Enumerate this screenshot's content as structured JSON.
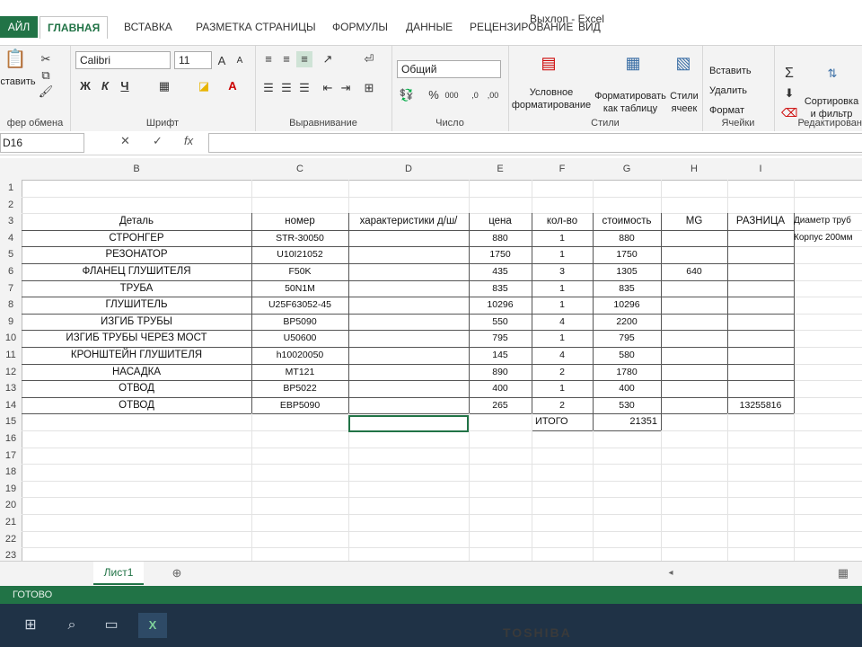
{
  "title": "Выхлоп - Excel",
  "tabs": {
    "file": "АЙЛ",
    "home": "ГЛАВНАЯ",
    "insert": "ВСТАВКА",
    "layout": "РАЗМЕТКА СТРАНИЦЫ",
    "formulas": "ФОРМУЛЫ",
    "data": "ДАННЫЕ",
    "review": "РЕЦЕНЗИРОВАНИЕ",
    "view": "ВИД"
  },
  "ribbon": {
    "paste": "ставить",
    "clipboard": "фер обмена",
    "font_name": "Calibri",
    "font_size": "11",
    "bold": "Ж",
    "italic": "К",
    "underline": "Ч",
    "font_group": "Шрифт",
    "align_group": "Выравнивание",
    "number_format": "Общий",
    "number_group": "Число",
    "cond_format": "Условное",
    "cond_format2": "форматирование",
    "format_table": "Форматировать",
    "format_table2": "как таблицу",
    "cell_styles": "Стили",
    "cell_styles2": "ячеек",
    "styles_group": "Стили",
    "insert": "Вставить",
    "delete": "Удалить",
    "format": "Формат",
    "cells_group": "Ячейки",
    "sort": "Сортировка",
    "sort2": "и фильтр",
    "edit_group": "Редактирован"
  },
  "formula_bar": {
    "name_box": "D16",
    "cancel": "✕",
    "enter": "✓",
    "fx": "fx",
    "value": ""
  },
  "columns": [
    "B",
    "C",
    "D",
    "E",
    "F",
    "G",
    "H",
    "I"
  ],
  "header_row": [
    "Деталь",
    "номер",
    "характеристики д/ш/",
    "цена",
    "кол-во",
    "стоимость",
    "MG",
    "РАЗНИЦА"
  ],
  "rows": [
    [
      "СТРОНГЕР",
      "STR-30050",
      "",
      "880",
      "1",
      "880",
      "",
      ""
    ],
    [
      "РЕЗОНАТОР",
      "U10I21052",
      "",
      "1750",
      "1",
      "1750",
      "",
      ""
    ],
    [
      "ФЛАНЕЦ ГЛУШИТЕЛЯ",
      "F50K",
      "",
      "435",
      "3",
      "1305",
      "640",
      ""
    ],
    [
      "ТРУБА",
      "50N1M",
      "",
      "835",
      "1",
      "835",
      "",
      ""
    ],
    [
      "ГЛУШИТЕЛЬ",
      "U25F63052-45",
      "",
      "10296",
      "1",
      "10296",
      "",
      ""
    ],
    [
      "ИЗГИБ ТРУБЫ",
      "BP5090",
      "",
      "550",
      "4",
      "2200",
      "",
      ""
    ],
    [
      "ИЗГИБ ТРУБЫ ЧЕРЕЗ МОСТ",
      "U50600",
      "",
      "795",
      "1",
      "795",
      "",
      ""
    ],
    [
      "КРОНШТЕЙН ГЛУШИТЕЛЯ",
      "h10020050",
      "",
      "145",
      "4",
      "580",
      "",
      ""
    ],
    [
      "НАСАДКА",
      "MT121",
      "",
      "890",
      "2",
      "1780",
      "",
      ""
    ],
    [
      "ОТВОД",
      "BP5022",
      "",
      "400",
      "1",
      "400",
      "",
      ""
    ],
    [
      "ОТВОД",
      "EBP5090",
      "",
      "265",
      "2",
      "530",
      "",
      "13255816"
    ]
  ],
  "total_label": "ИТОГО",
  "total_value": "21351",
  "side_note_1": "Диаметр труб",
  "side_note_2": "Корпус 200мм",
  "row_numbers": [
    "1",
    "2",
    "3",
    "4",
    "5",
    "6",
    "7",
    "8",
    "9",
    "10",
    "11",
    "12",
    "13",
    "14",
    "15",
    "16",
    "17",
    "18",
    "19",
    "20",
    "21",
    "22",
    "23"
  ],
  "sheet_tab": "Лист1",
  "status": "ГОТОВО",
  "brand": "TOSHIBA"
}
